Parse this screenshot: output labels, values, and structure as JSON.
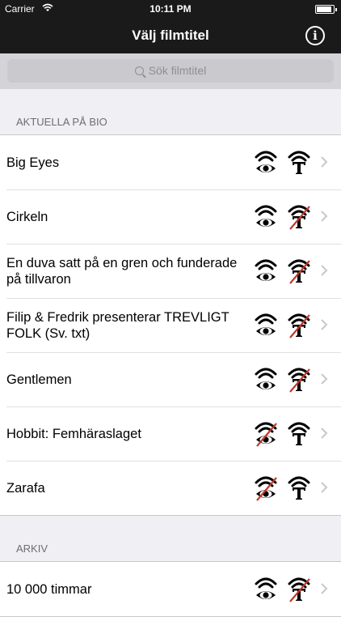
{
  "status": {
    "carrier": "Carrier",
    "time": "10:11 PM"
  },
  "nav": {
    "title": "Välj filmtitel",
    "info_icon": "info-icon"
  },
  "search": {
    "placeholder": "Sök filmtitel"
  },
  "sections": [
    {
      "header": "AKTUELLA PÅ BIO",
      "rows": [
        {
          "title": "Big Eyes",
          "audio": true,
          "text": true
        },
        {
          "title": "Cirkeln",
          "audio": true,
          "text": false
        },
        {
          "title": "En duva satt på en gren och funderade på tillvaron",
          "audio": true,
          "text": false
        },
        {
          "title": "Filip & Fredrik presenterar TREVLIGT FOLK (Sv. txt)",
          "audio": true,
          "text": false
        },
        {
          "title": "Gentlemen",
          "audio": true,
          "text": false
        },
        {
          "title": "Hobbit: Femhäraslaget",
          "audio": false,
          "text": true
        },
        {
          "title": "Zarafa",
          "audio": false,
          "text": true
        }
      ]
    },
    {
      "header": "ARKIV",
      "rows": [
        {
          "title": "10 000 timmar",
          "audio": true,
          "text": false
        }
      ]
    }
  ],
  "colors": {
    "strike": "#c0392b",
    "nav_bg": "#1a1a1a"
  }
}
